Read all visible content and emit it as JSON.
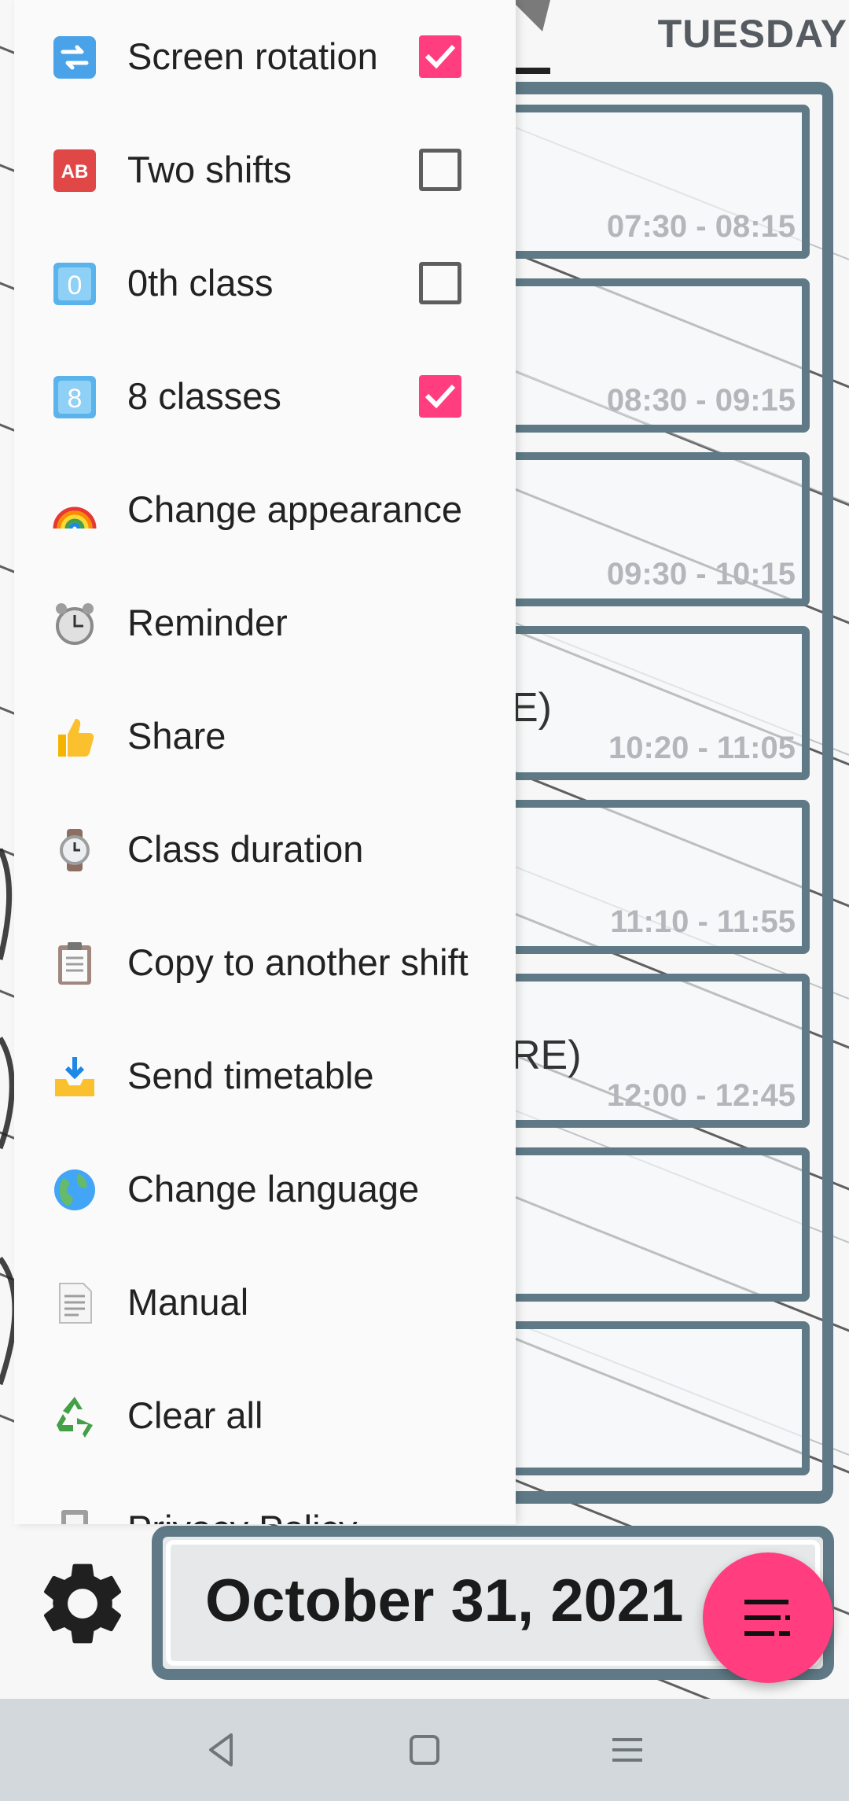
{
  "header": {
    "day": "TUESDAY"
  },
  "timetable": {
    "slots": [
      {
        "subject": "",
        "time": "07:30 - 08:15"
      },
      {
        "subject": "",
        "time": "08:30 - 09:15"
      },
      {
        "subject": "",
        "time": "09:30 - 10:15"
      },
      {
        "subject": "E)",
        "time": "10:20 - 11:05"
      },
      {
        "subject": "",
        "time": "11:10 - 11:55"
      },
      {
        "subject": "RE)",
        "time": "12:00 - 12:45"
      },
      {
        "subject": "",
        "time": ""
      },
      {
        "subject": "",
        "time": ""
      }
    ]
  },
  "bottom": {
    "date": "October 31, 2021",
    "settings_icon": "gear-icon",
    "fab_icon": "menu-lines-icon",
    "accent": "#ff3d7f",
    "frame_color": "#5f7a86"
  },
  "drawer": {
    "items": [
      {
        "label": "Screen rotation",
        "icon": "rotate-arrows-icon",
        "checked": true
      },
      {
        "label": "Two shifts",
        "icon": "ab-icon",
        "checked": false
      },
      {
        "label": "0th class",
        "icon": "keycap-zero-icon",
        "checked": false
      },
      {
        "label": "8 classes",
        "icon": "keycap-eight-icon",
        "checked": true
      },
      {
        "label": "Change appearance",
        "icon": "rainbow-icon"
      },
      {
        "label": "Reminder",
        "icon": "alarm-clock-icon"
      },
      {
        "label": "Share",
        "icon": "thumbs-up-icon"
      },
      {
        "label": "Class duration",
        "icon": "watch-icon"
      },
      {
        "label": "Copy to another shift",
        "icon": "clipboard-icon"
      },
      {
        "label": "Send timetable",
        "icon": "inbox-tray-icon"
      },
      {
        "label": "Change language",
        "icon": "globe-icon"
      },
      {
        "label": "Manual",
        "icon": "page-icon"
      },
      {
        "label": "Clear all",
        "icon": "recycle-icon"
      },
      {
        "label": "Privacy Policy",
        "icon": "document-icon"
      }
    ]
  },
  "navbar": {
    "back": "back-icon",
    "home": "home-icon",
    "recents": "recents-icon"
  }
}
